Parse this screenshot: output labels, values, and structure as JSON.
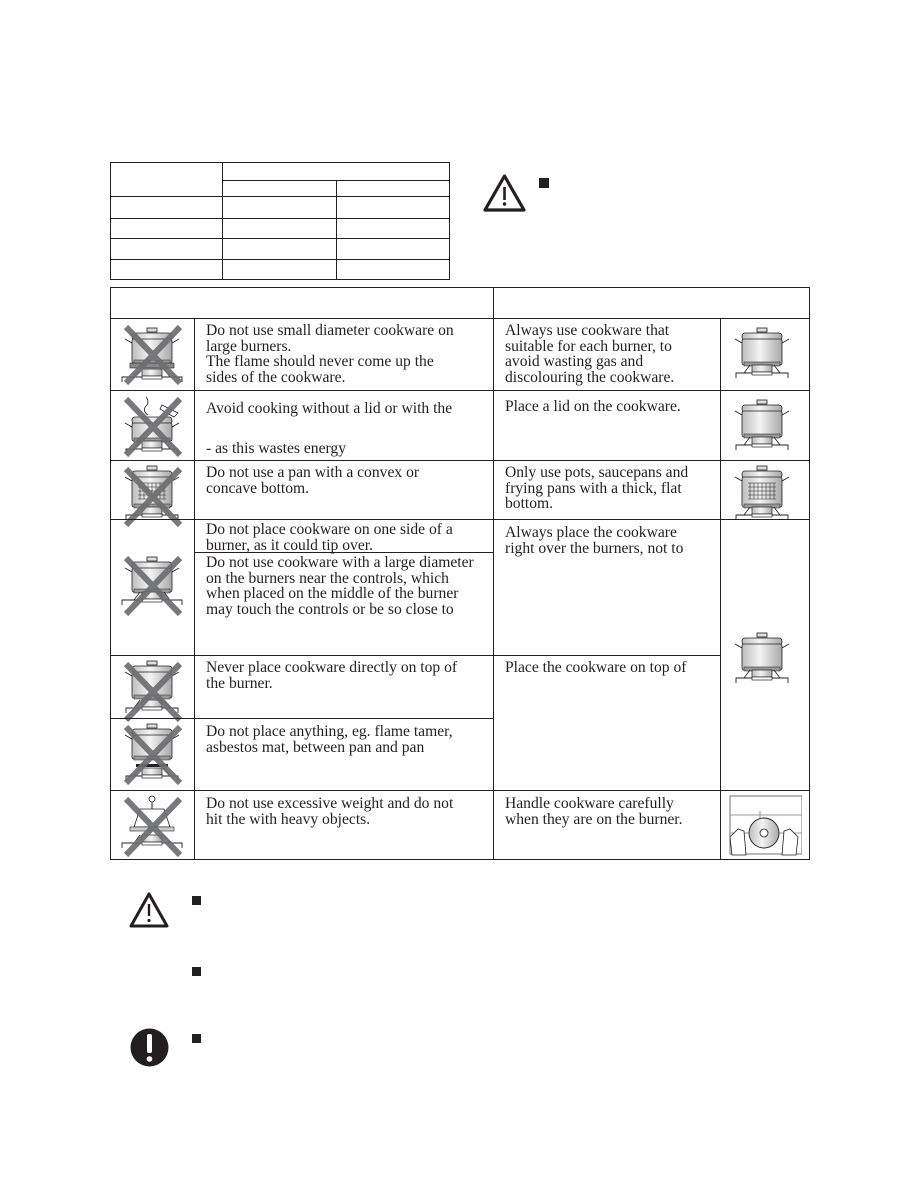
{
  "burner_table": {
    "header_merged": "",
    "header_left": "",
    "subheaders": [
      "",
      ""
    ],
    "rows": [
      [
        "",
        "",
        ""
      ],
      [
        "",
        "",
        ""
      ],
      [
        "",
        "",
        ""
      ],
      [
        "",
        "",
        ""
      ]
    ]
  },
  "top_warning": {
    "icon": "warning-triangle-icon",
    "bullet_text": ""
  },
  "cookware_table": {
    "header_wrong": "",
    "header_right": "",
    "rows": [
      {
        "wrong_icon": "pot-small-on-large-burner-crossed",
        "wrong_text": "Do not use small diameter cookware on\nlarge burners.\nThe flame should never come up the\nsides of the cookware.",
        "right_text": "Always use cookware that\nsuitable for each burner, to\navoid wasting gas and\ndiscolouring the cookware.",
        "right_icon": "pot-correct-size"
      },
      {
        "wrong_icon": "pot-without-lid-crossed",
        "wrong_text": "Avoid cooking without a lid or with the\n\n- as this wastes energy",
        "right_text": "Place  a  lid on the  cookware.",
        "right_icon": "pot-with-lid"
      },
      {
        "wrong_icon": "pot-convex-bottom-crossed",
        "wrong_text": "Do not use a pan with a convex or\nconcave bottom.",
        "right_text": "Only use pots, saucepans and\nfrying pans with a thick, flat\nbottom.",
        "right_icon": "pot-flat-bottom"
      },
      {
        "wrong_icon": "pot-off-center-crossed",
        "wrong_text_a": "Do not place cookware on one side of a\nburner, as it could tip over.",
        "wrong_text_b": "Do not use cookware with a large diameter\non the burners near the controls, which\nwhen placed on the middle of the burner\nmay touch the controls or be so close to",
        "right_text": "Always place the cookware\nright over the burners, not to",
        "right_icon": "pot-centered-on-burner"
      },
      {
        "wrong_icon": "pot-directly-on-burner-crossed",
        "wrong_text": "Never place cookware directly on top of\nthe burner.",
        "right_text": "Place the cookware on top of"
      },
      {
        "wrong_icon": "pot-with-flame-tamer-crossed",
        "wrong_text": "Do not place anything, eg. flame tamer,\nasbestos mat, between pan and pan"
      },
      {
        "wrong_icon": "excessive-weight-crossed",
        "wrong_text": "Do not use excessive weight and do not\nhit the                  with heavy objects.",
        "right_text": "Handle cookware carefully\nwhen they are on the burner.",
        "right_icon": "hands-holding-pot-on-grid"
      }
    ]
  },
  "bottom_notes": [
    {
      "icon": "warning-triangle-icon",
      "text": ""
    },
    {
      "icon": "",
      "text": ""
    },
    {
      "icon": "exclamation-circle-icon",
      "text": ""
    }
  ],
  "colors": {
    "ink": "#231f20",
    "cross": "#6d6e71",
    "pot_fill": "#d9d9d9"
  }
}
